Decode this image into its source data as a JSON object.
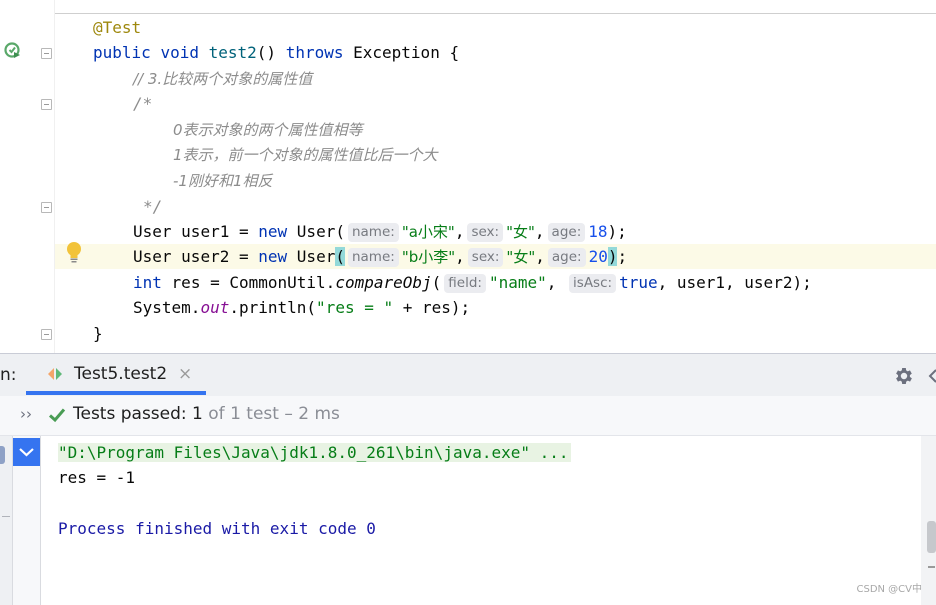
{
  "editor": {
    "annotation": "@Test",
    "sig": {
      "kw_public": "public",
      "kw_void": "void",
      "method": "test2",
      "parens": "()",
      "kw_throws": "throws",
      "exception": "Exception {"
    },
    "comment_line": "// 3.比较两个对象的属性值",
    "block_open": "/*",
    "doc1": "0表示对象的两个属性值相等",
    "doc2": "1表示，前一个对象的属性值比后一个大",
    "doc3": "-1刚好和1相反",
    "block_close": "*/",
    "line1": {
      "type": "User",
      "var": "user1 =",
      "kw_new": "new",
      "ctor": "User(",
      "hint_name": "name:",
      "arg_name": "\"a小宋\"",
      "hint_sex": "sex:",
      "arg_sex": "\"女\"",
      "hint_age": "age:",
      "arg_age": "18",
      "end": ");"
    },
    "line2": {
      "type": "User",
      "var": "user2 =",
      "kw_new": "new",
      "ctor": "User",
      "paren_open": "(",
      "hint_name": "name:",
      "arg_name": "\"b小李\"",
      "hint_sex": "sex:",
      "arg_sex": "\"女\"",
      "hint_age": "age:",
      "arg_age": "20",
      "paren_close": ")",
      "end": ";"
    },
    "line3": {
      "kw_int": "int",
      "lhs": "res = CommonUtil.",
      "call": "compareObj",
      "open": "(",
      "hint_field": "field:",
      "arg_field": "\"name\"",
      "hint_asc": "isAsc:",
      "arg_asc": "true",
      "rest": ", user1, user2);"
    },
    "line4": {
      "system": "System.",
      "out": "out",
      "print": ".println(",
      "str": "\"res = \"",
      "rest": " + res);"
    },
    "close_brace": "}"
  },
  "run": {
    "label": "n:",
    "tab_title": "Test5.test2",
    "tab_close": "×",
    "expand_glyph": "››",
    "status_passed": "Tests passed:",
    "status_count": "1",
    "status_rest": "of 1 test – 2 ms",
    "console": {
      "cmd": "\"D:\\Program Files\\Java\\jdk1.8.0_261\\bin\\java.exe\" ...",
      "output": "res = -1",
      "exit": "Process finished with exit code 0"
    },
    "watermark": "CSDN @CV中"
  },
  "colors": {
    "accent": "#3574f0",
    "pass_green": "#499c54",
    "keyword": "#0033b3",
    "string": "#067d17",
    "comment": "#8c8c8c"
  }
}
